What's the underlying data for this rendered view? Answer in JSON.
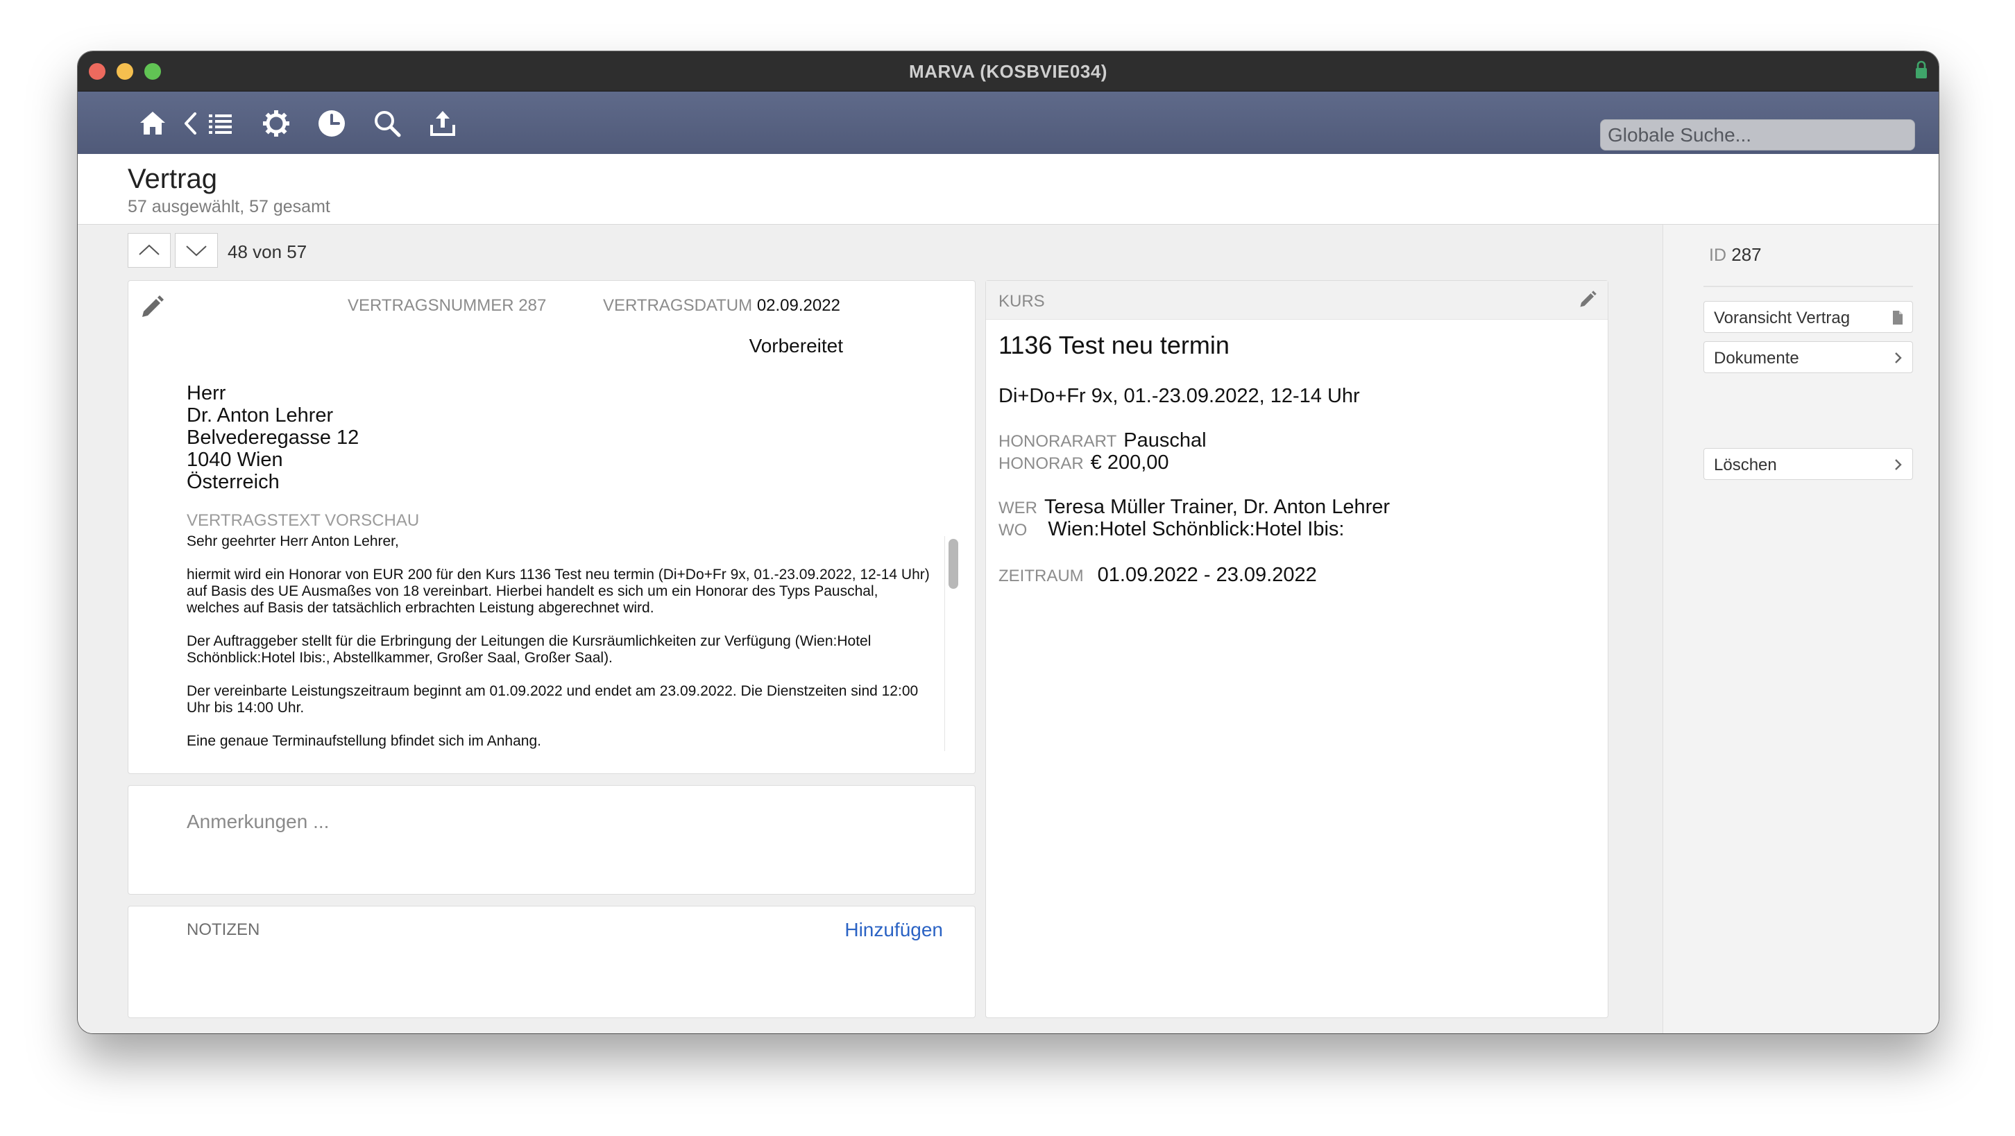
{
  "window": {
    "title": "MARVA (KOSBVIE034)"
  },
  "toolbar": {
    "icons": [
      "home-icon",
      "back-icon",
      "list-icon",
      "gear-icon",
      "clock-icon",
      "search-icon",
      "upload-icon"
    ],
    "search_placeholder": "Globale Suche..."
  },
  "header": {
    "title": "Vertrag",
    "subtitle": "57 ausgewählt, 57 gesamt"
  },
  "navigation": {
    "position": "48 von 57"
  },
  "contract": {
    "number_label": "VERTRAGSNUMMER",
    "number": "287",
    "date_label": "VERTRAGSDATUM",
    "date": "02.09.2022",
    "status": "Vorbereitet",
    "address": [
      "Herr",
      "Dr. Anton Lehrer",
      "Belvederegasse 12",
      "1040 Wien",
      "Österreich"
    ],
    "preview_label": "VERTRAGSTEXT VORSCHAU",
    "preview_paragraphs": [
      "Sehr geehrter Herr Anton Lehrer,",
      "hiermit wird ein Honorar von EUR 200 für den Kurs 1136 Test neu termin (Di+Do+Fr 9x, 01.-23.09.2022, 12-14 Uhr) auf Basis des UE Ausmaßes von 18 vereinbart. Hierbei handelt es sich um ein Honorar des Typs Pauschal, welches auf Basis der tatsächlich erbrachten Leistung abgerechnet wird.",
      "Der Auftraggeber stellt für die Erbringung der Leitungen die Kursräumlichkeiten zur Verfügung (Wien:Hotel Schönblick:Hotel Ibis:, Abstellkammer, Großer Saal, Großer Saal).",
      "Der vereinbarte Leistungszeitraum beginnt am 01.09.2022 und endet am 23.09.2022. Die Dienstzeiten sind 12:00 Uhr bis 14:00 Uhr.",
      "Eine genaue Terminaufstellung bfindet sich im Anhang."
    ]
  },
  "remarks": {
    "placeholder": "Anmerkungen ..."
  },
  "notes": {
    "label": "NOTIZEN",
    "add_label": "Hinzufügen"
  },
  "course": {
    "label": "KURS",
    "title": "1136 Test neu termin",
    "schedule": "Di+Do+Fr 9x, 01.-23.09.2022, 12-14 Uhr",
    "fee_type_label": "HONORARART",
    "fee_type": "Pauschal",
    "fee_label": "HONORAR",
    "fee": "€ 200,00",
    "who_label": "WER",
    "who": "Teresa Müller Trainer, Dr. Anton Lehrer",
    "where_label": "WO",
    "where": "Wien:Hotel Schönblick:Hotel Ibis:",
    "period_label": "ZEITRAUM",
    "period": "01.09.2022 - 23.09.2022"
  },
  "sidebar": {
    "id_label": "ID",
    "id": "287",
    "preview_button": "Voransicht Vertrag",
    "documents_button": "Dokumente",
    "delete_button": "Löschen"
  },
  "colors": {
    "toolbar": "#566080",
    "link": "#2b63c4",
    "titlebar": "#2e2e2e"
  }
}
